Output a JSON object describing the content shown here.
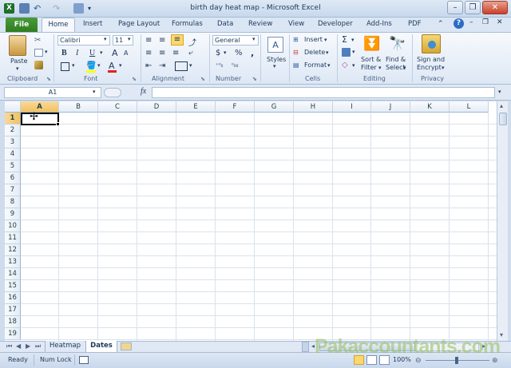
{
  "window": {
    "title": "birth day heat map - Microsoft Excel",
    "minimize": "–",
    "restore": "❐",
    "close": "✕"
  },
  "ribbon_tabs": [
    "File",
    "Home",
    "Insert",
    "Page Layout",
    "Formulas",
    "Data",
    "Review",
    "View",
    "Developer",
    "Add-Ins",
    "PDF"
  ],
  "clipboard": {
    "paste": "Paste",
    "label": "Clipboard"
  },
  "font": {
    "name": "Calibri",
    "size": "11",
    "bold": "B",
    "italic": "I",
    "underline": "U",
    "grow": "A",
    "shrink": "A",
    "color": "A",
    "label": "Font"
  },
  "alignment": {
    "label": "Alignment"
  },
  "number": {
    "format": "General",
    "currency": "$",
    "percent": "%",
    "comma": ",",
    "label": "Number"
  },
  "styles": {
    "label": "Styles"
  },
  "cells": {
    "insert": "Insert",
    "delete": "Delete",
    "format": "Format",
    "label": "Cells"
  },
  "editing": {
    "sort_line1": "Sort &",
    "sort_line2": "Filter",
    "find_line1": "Find &",
    "find_line2": "Select",
    "label": "Editing"
  },
  "privacy": {
    "sign_line1": "Sign and",
    "sign_line2": "Encrypt",
    "label": "Privacy"
  },
  "formula_bar": {
    "name_box": "A1",
    "fx": "fx",
    "value": ""
  },
  "grid": {
    "columns": [
      "A",
      "B",
      "C",
      "D",
      "E",
      "F",
      "G",
      "H",
      "I",
      "J",
      "K",
      "L"
    ],
    "rows": [
      "1",
      "2",
      "3",
      "4",
      "5",
      "6",
      "7",
      "8",
      "9",
      "10",
      "11",
      "12",
      "13",
      "14",
      "15",
      "16",
      "17",
      "18",
      "19"
    ],
    "active_cell": "A1"
  },
  "sheets": {
    "tabs": [
      "Heatmap",
      "Dates"
    ],
    "active": "Dates"
  },
  "status": {
    "mode": "Ready",
    "num_lock": "Num Lock",
    "zoom": "100%"
  },
  "watermark": "Pakaccountants.com",
  "colors": {
    "file_tab": "#2e7d1f",
    "accent": "#1e395b",
    "grid_line": "#dae2ec",
    "selection": "#000000"
  }
}
